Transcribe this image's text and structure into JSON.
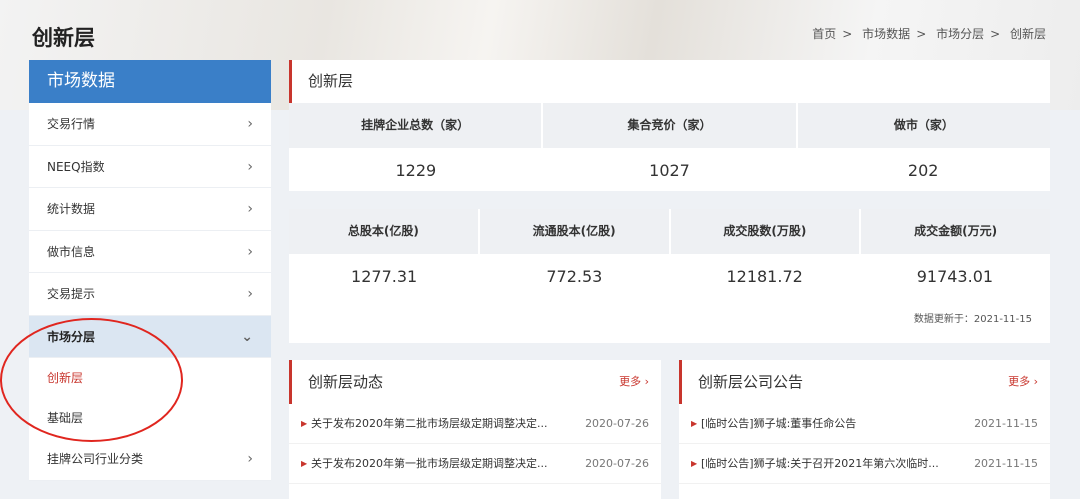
{
  "header": {
    "title": "创新层",
    "breadcrumb": [
      "首页",
      "市场数据",
      "市场分层",
      "创新层"
    ]
  },
  "sidebar": {
    "heading": "市场数据",
    "items": [
      {
        "label": "交易行情"
      },
      {
        "label": "NEEQ指数"
      },
      {
        "label": "统计数据"
      },
      {
        "label": "做市信息"
      },
      {
        "label": "交易提示"
      },
      {
        "label": "市场分层"
      },
      {
        "label": "挂牌公司行业分类"
      }
    ],
    "sub_items": [
      {
        "label": "创新层"
      },
      {
        "label": "基础层"
      }
    ],
    "chevron_right": "›",
    "chevron_down": "⌄"
  },
  "stats": {
    "title": "创新层",
    "table1": {
      "headers": [
        "挂牌企业总数（家）",
        "集合竞价（家）",
        "做市（家）"
      ],
      "values": [
        "1229",
        "1027",
        "202"
      ]
    },
    "table2": {
      "headers": [
        "总股本(亿股)",
        "流通股本(亿股)",
        "成交股数(万股)",
        "成交金额(万元)"
      ],
      "values": [
        "1277.31",
        "772.53",
        "12181.72",
        "91743.01"
      ]
    },
    "update_text": "数据更新于：2021-11-15"
  },
  "news": {
    "title": "创新层动态",
    "more": "更多 ›",
    "rows": [
      {
        "title": "关于发布2020年第二批市场层级定期调整决定...",
        "date": "2020-07-26"
      },
      {
        "title": "关于发布2020年第一批市场层级定期调整决定...",
        "date": "2020-07-26"
      }
    ]
  },
  "announcements": {
    "title": "创新层公司公告",
    "more": "更多 ›",
    "rows": [
      {
        "title": "[临时公告]狮子城:董事任命公告",
        "date": "2021-11-15"
      },
      {
        "title": "[临时公告]狮子城:关于召开2021年第六次临时...",
        "date": "2021-11-15"
      }
    ]
  },
  "colors": {
    "accent_blue": "#3a7fc8",
    "accent_red": "#c8352d",
    "annotation_circle": "#e0261f"
  }
}
